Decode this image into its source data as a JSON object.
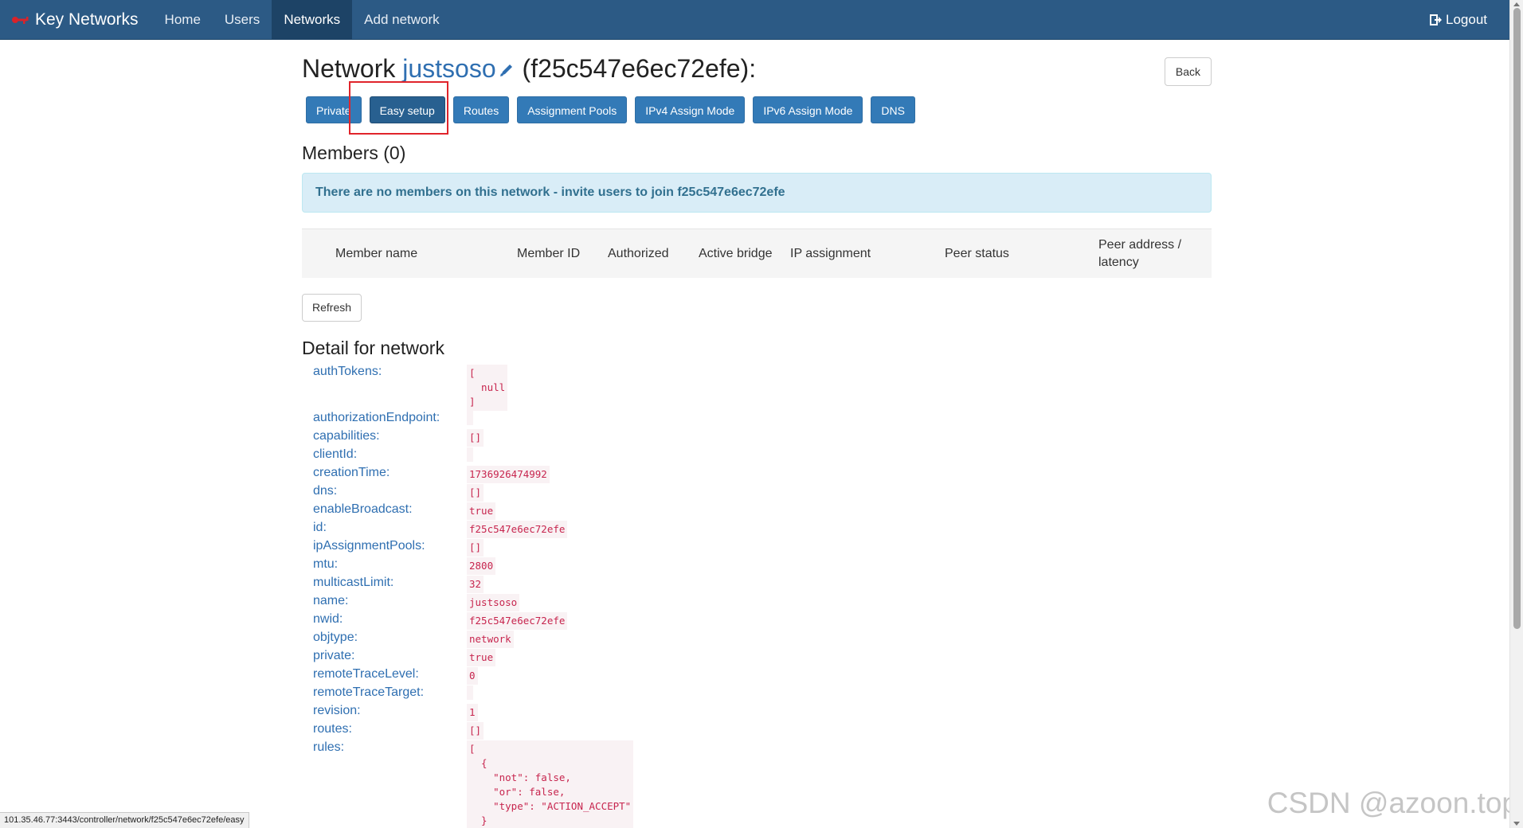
{
  "navbar": {
    "brand": "Key Networks",
    "items": [
      {
        "label": "Home",
        "active": false
      },
      {
        "label": "Users",
        "active": false
      },
      {
        "label": "Networks",
        "active": true
      },
      {
        "label": "Add network",
        "active": false
      }
    ],
    "logout": "Logout"
  },
  "page": {
    "title_prefix": "Network",
    "network_name": "justsoso",
    "network_id_paren": "(f25c547e6ec72efe):",
    "back": "Back"
  },
  "buttons": [
    "Private",
    "Easy setup",
    "Routes",
    "Assignment Pools",
    "IPv4 Assign Mode",
    "IPv6 Assign Mode",
    "DNS"
  ],
  "members": {
    "heading": "Members (0)",
    "alert": "There are no members on this network - invite users to join f25c547e6ec72efe",
    "columns": [
      "Member name",
      "Member ID",
      "Authorized",
      "Active bridge",
      "IP assignment",
      "Peer status",
      "Peer address / latency"
    ],
    "refresh": "Refresh"
  },
  "detail": {
    "heading": "Detail for network",
    "rows": [
      {
        "key": "authTokens:",
        "value": "[\n  null\n]"
      },
      {
        "key": "authorizationEndpoint:",
        "value": ""
      },
      {
        "key": "capabilities:",
        "value": "[]"
      },
      {
        "key": "clientId:",
        "value": ""
      },
      {
        "key": "creationTime:",
        "value": "1736926474992"
      },
      {
        "key": "dns:",
        "value": "[]"
      },
      {
        "key": "enableBroadcast:",
        "value": "true"
      },
      {
        "key": "id:",
        "value": "f25c547e6ec72efe"
      },
      {
        "key": "ipAssignmentPools:",
        "value": "[]"
      },
      {
        "key": "mtu:",
        "value": "2800"
      },
      {
        "key": "multicastLimit:",
        "value": "32"
      },
      {
        "key": "name:",
        "value": "justsoso"
      },
      {
        "key": "nwid:",
        "value": "f25c547e6ec72efe"
      },
      {
        "key": "objtype:",
        "value": "network"
      },
      {
        "key": "private:",
        "value": "true"
      },
      {
        "key": "remoteTraceLevel:",
        "value": "0"
      },
      {
        "key": "remoteTraceTarget:",
        "value": ""
      },
      {
        "key": "revision:",
        "value": "1"
      },
      {
        "key": "routes:",
        "value": "[]"
      },
      {
        "key": "rules:",
        "value": "[\n  {\n    \"not\": false,\n    \"or\": false,\n    \"type\": \"ACTION_ACCEPT\"\n  }"
      }
    ]
  },
  "status_url": "101.35.46.77:3443/controller/network/f25c547e6ec72efe/easy",
  "watermark": "CSDN @azoon.top",
  "colors": {
    "navbar": "#2c5a85",
    "primary": "#337ab7",
    "link": "#2f6fb1",
    "highlight": "#e0242b",
    "alert_bg": "#d9edf7"
  }
}
